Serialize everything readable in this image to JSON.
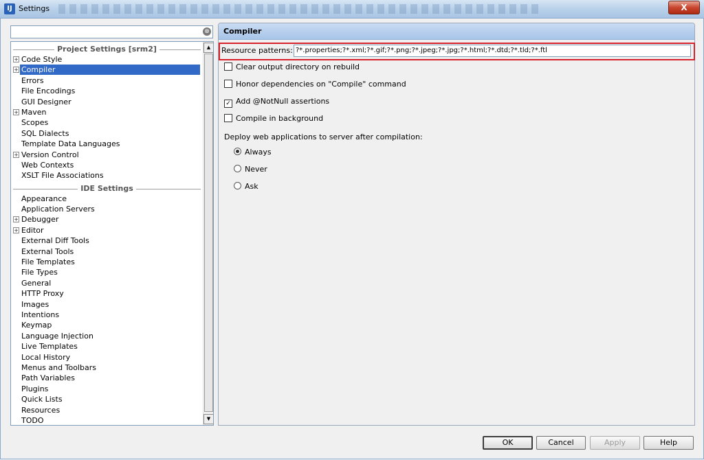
{
  "window": {
    "icon_text": "IJ",
    "title": "Settings",
    "close_label": "X"
  },
  "search": {
    "placeholder": "",
    "value": "",
    "clear_icon": "⊗"
  },
  "tree": {
    "project_header": "Project Settings [srm2]",
    "project_items": [
      {
        "label": "Code Style",
        "expandable": true
      },
      {
        "label": "Compiler",
        "expandable": true,
        "selected": true
      },
      {
        "label": "Errors",
        "expandable": false
      },
      {
        "label": "File Encodings",
        "expandable": false
      },
      {
        "label": "GUI Designer",
        "expandable": false
      },
      {
        "label": "Maven",
        "expandable": true
      },
      {
        "label": "Scopes",
        "expandable": false
      },
      {
        "label": "SQL Dialects",
        "expandable": false
      },
      {
        "label": "Template Data Languages",
        "expandable": false
      },
      {
        "label": "Version Control",
        "expandable": true
      },
      {
        "label": "Web Contexts",
        "expandable": false
      },
      {
        "label": "XSLT File Associations",
        "expandable": false
      }
    ],
    "ide_header": "IDE Settings",
    "ide_items": [
      {
        "label": "Appearance",
        "expandable": false
      },
      {
        "label": "Application Servers",
        "expandable": false
      },
      {
        "label": "Debugger",
        "expandable": true
      },
      {
        "label": "Editor",
        "expandable": true
      },
      {
        "label": "External Diff Tools",
        "expandable": false
      },
      {
        "label": "External Tools",
        "expandable": false
      },
      {
        "label": "File Templates",
        "expandable": false
      },
      {
        "label": "File Types",
        "expandable": false
      },
      {
        "label": "General",
        "expandable": false
      },
      {
        "label": "HTTP Proxy",
        "expandable": false
      },
      {
        "label": "Images",
        "expandable": false
      },
      {
        "label": "Intentions",
        "expandable": false
      },
      {
        "label": "Keymap",
        "expandable": false
      },
      {
        "label": "Language Injection",
        "expandable": false
      },
      {
        "label": "Live Templates",
        "expandable": false
      },
      {
        "label": "Local History",
        "expandable": false
      },
      {
        "label": "Menus and Toolbars",
        "expandable": false
      },
      {
        "label": "Path Variables",
        "expandable": false
      },
      {
        "label": "Plugins",
        "expandable": false
      },
      {
        "label": "Quick Lists",
        "expandable": false
      },
      {
        "label": "Resources",
        "expandable": false
      },
      {
        "label": "TODO",
        "expandable": false
      }
    ]
  },
  "compiler": {
    "title": "Compiler",
    "resource_label": "Resource patterns:",
    "resource_value": "?*.properties;?*.xml;?*.gif;?*.png;?*.jpeg;?*.jpg;?*.html;?*.dtd;?*.tld;?*.ftl",
    "options": [
      {
        "label": "Clear output directory on rebuild",
        "checked": false
      },
      {
        "label": "Honor dependencies on \"Compile\" command",
        "checked": false
      },
      {
        "label": "Add @NotNull assertions",
        "checked": true
      },
      {
        "label": "Compile in background",
        "checked": false
      }
    ],
    "deploy_label": "Deploy web applications to server after compilation:",
    "deploy_options": [
      {
        "label": "Always",
        "selected": true
      },
      {
        "label": "Never",
        "selected": false
      },
      {
        "label": "Ask",
        "selected": false
      }
    ]
  },
  "buttons": {
    "ok": "OK",
    "cancel": "Cancel",
    "apply": "Apply",
    "help": "Help"
  },
  "colors": {
    "selection": "#3169c6",
    "highlight_border": "#d8202a",
    "header_blue": "#a7c4e8"
  }
}
